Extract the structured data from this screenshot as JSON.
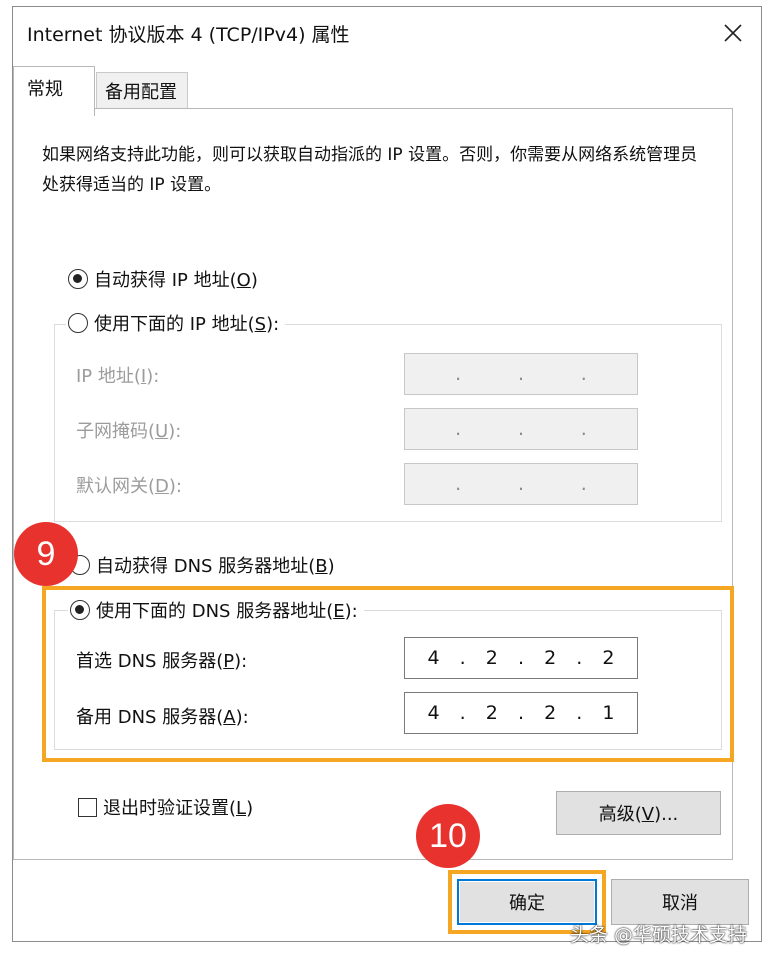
{
  "window": {
    "title": "Internet 协议版本 4 (TCP/IPv4) 属性"
  },
  "tabs": [
    {
      "label": "常规",
      "active": true
    },
    {
      "label": "备用配置",
      "active": false
    }
  ],
  "description": "如果网络支持此功能，则可以获取自动指派的 IP 设置。否则，你需要从网络系统管理员处获得适当的 IP 设置。",
  "ip_section": {
    "auto_radio": {
      "label": "自动获得 IP 地址",
      "key": "O",
      "checked": true
    },
    "manual_radio": {
      "label": "使用下面的 IP 地址",
      "key": "S",
      "checked": false
    },
    "fields": [
      {
        "label": "IP 地址",
        "key": "I",
        "value": [
          "",
          "",
          "",
          ""
        ]
      },
      {
        "label": "子网掩码",
        "key": "U",
        "value": [
          "",
          "",
          "",
          ""
        ]
      },
      {
        "label": "默认网关",
        "key": "D",
        "value": [
          "",
          "",
          "",
          ""
        ]
      }
    ]
  },
  "dns_section": {
    "auto_radio": {
      "label": "自动获得 DNS 服务器地址",
      "key": "B",
      "checked": false
    },
    "manual_radio": {
      "label": "使用下面的 DNS 服务器地址",
      "key": "E",
      "checked": true
    },
    "fields": [
      {
        "label": "首选 DNS 服务器",
        "key": "P",
        "value": [
          "4",
          "2",
          "2",
          "2"
        ]
      },
      {
        "label": "备用 DNS 服务器",
        "key": "A",
        "value": [
          "4",
          "2",
          "2",
          "1"
        ]
      }
    ]
  },
  "validate_checkbox": {
    "label": "退出时验证设置",
    "key": "L",
    "checked": false
  },
  "buttons": {
    "advanced": {
      "label": "高级",
      "key": "V",
      "suffix": "..."
    },
    "ok": "确定",
    "cancel": "取消"
  },
  "annotations": {
    "step9": "9",
    "step10": "10",
    "highlight_color": "#f5a623",
    "badge_color": "#e8322e"
  },
  "watermark": "头条 @华硕技术支持"
}
